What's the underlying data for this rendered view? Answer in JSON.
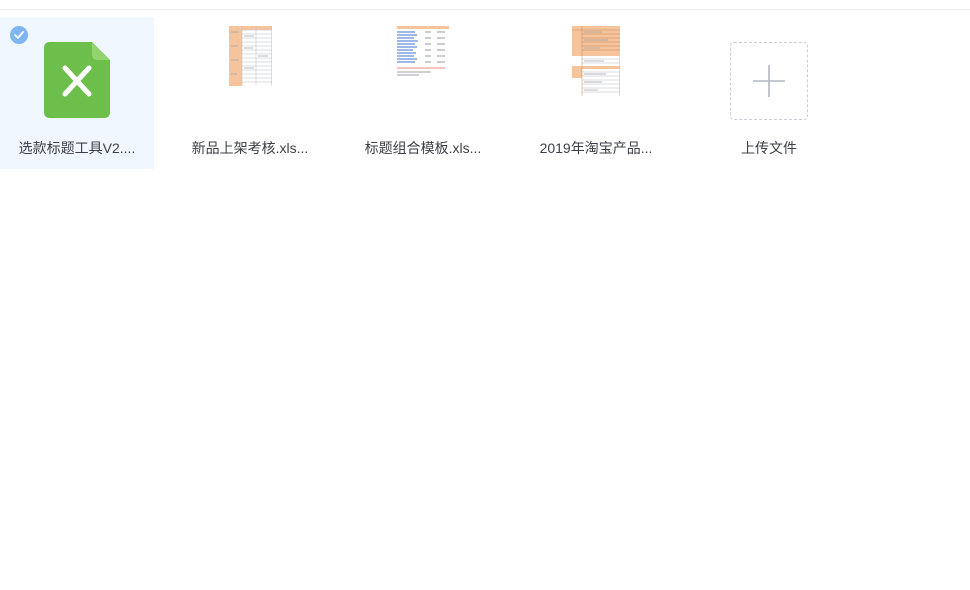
{
  "files": [
    {
      "name": "选款标题工具V2....",
      "icon": "excel-icon",
      "selected": true
    },
    {
      "name": "新品上架考核.xls...",
      "icon": "spreadsheet-thumbnail"
    },
    {
      "name": "标题组合模板.xls...",
      "icon": "spreadsheet-thumbnail"
    },
    {
      "name": "2019年淘宝产品...",
      "icon": "spreadsheet-thumbnail"
    }
  ],
  "upload": {
    "label": "上传文件",
    "icon": "plus-icon"
  },
  "colors": {
    "excel_green": "#6dbf4b",
    "selected_bg": "#f1f7fe",
    "check_blue": "#7fb6f2",
    "sheet_orange": "#f6c49c"
  }
}
